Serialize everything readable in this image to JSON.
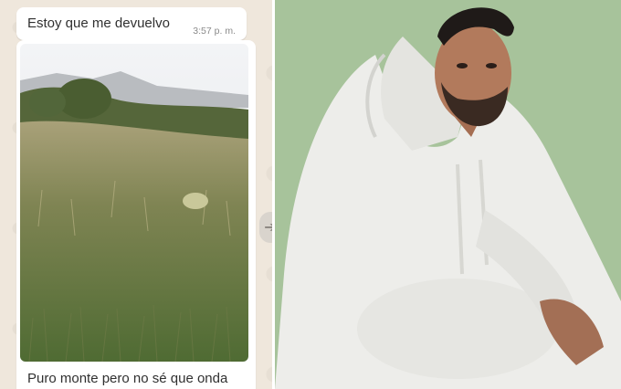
{
  "chat": {
    "message": {
      "text": "Estoy que me devuelvo",
      "time": "3:57 p. m."
    },
    "image_message": {
      "caption": "Puro monte pero no sé que onda"
    }
  },
  "colors": {
    "chat_background": "#efe7dc",
    "bubble": "#ffffff",
    "portrait_background": "#a7c39b"
  }
}
